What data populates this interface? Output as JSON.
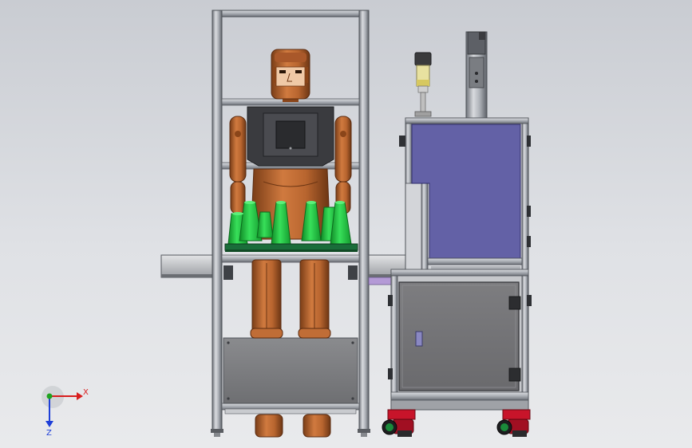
{
  "triad": {
    "x_label": "X",
    "z_label": "Z",
    "x_color": "#d81e1e",
    "y_color": "#1fa31f",
    "z_color": "#1e3fd8"
  },
  "colors": {
    "frame": "#b8bcc2",
    "frame_dark": "#5c6068",
    "robot": "#b8652f",
    "robot_dark": "#6d3614",
    "cups": "#21c23f",
    "cabinet_window": "#6361a6",
    "cabinet_lower": "#7c7c7e",
    "caster": "#c8142a"
  }
}
